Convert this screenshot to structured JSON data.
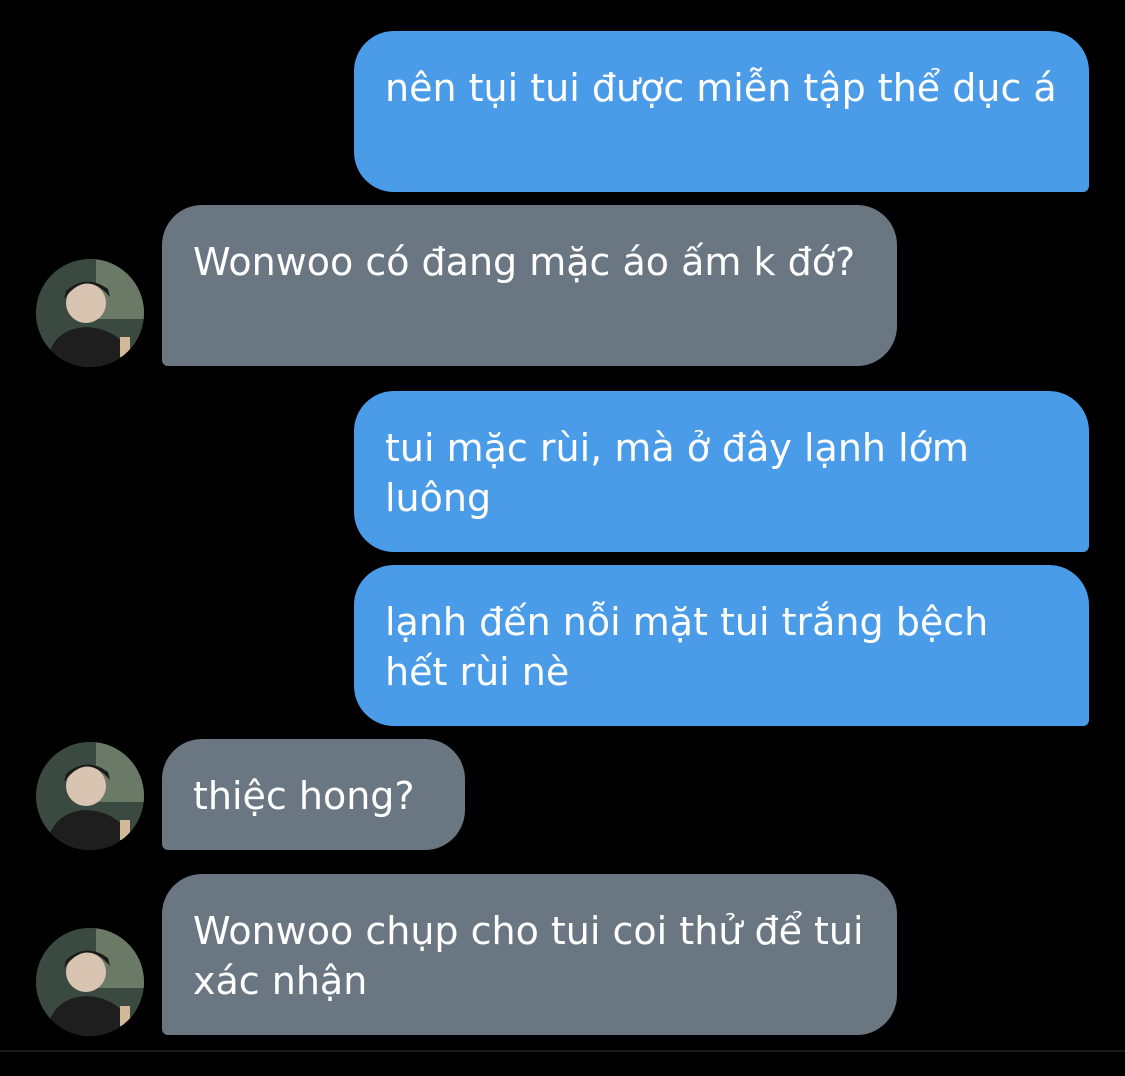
{
  "conversation": {
    "messages": [
      {
        "sender": "me",
        "text": "nên tụi tui được miễn tập thể dục á"
      },
      {
        "sender": "contact",
        "text": "Wonwoo có đang mặc áo ấm k đớ?"
      },
      {
        "sender": "me",
        "text": "tui mặc rùi, mà ở đây lạnh lớm luông"
      },
      {
        "sender": "me",
        "text": "lạnh đến nỗi mặt tui trắng bệch hết rùi nè"
      },
      {
        "sender": "contact",
        "text": "thiệc hong?"
      },
      {
        "sender": "contact",
        "text": "Wonwoo chụp cho tui coi thử để tui xác nhận"
      }
    ]
  },
  "colors": {
    "background": "#000000",
    "sent_bubble": "#4a9be8",
    "received_bubble": "#6a7682",
    "text": "#ffffff"
  },
  "icons": {
    "contact_avatar": "profile-photo-icon"
  }
}
